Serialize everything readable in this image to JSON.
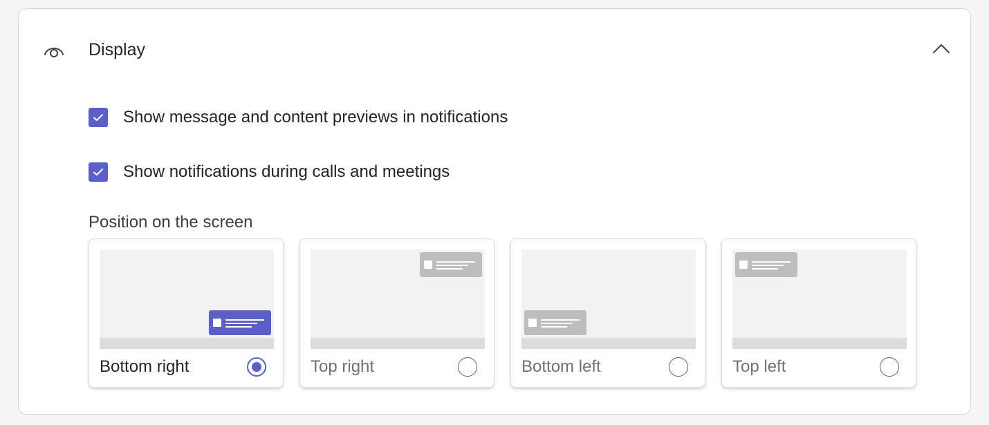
{
  "section": {
    "title": "Display",
    "icon": "eye-icon",
    "collapse_icon": "chevron-up-icon"
  },
  "checkboxes": [
    {
      "label": "Show message and content previews in notifications",
      "checked": true
    },
    {
      "label": "Show notifications during calls and meetings",
      "checked": true
    }
  ],
  "position": {
    "label": "Position on the screen",
    "options": [
      {
        "label": "Bottom right",
        "selected": true
      },
      {
        "label": "Top right",
        "selected": false
      },
      {
        "label": "Bottom left",
        "selected": false
      },
      {
        "label": "Top left",
        "selected": false
      }
    ]
  },
  "colors": {
    "accent": "#5b5fc7",
    "toast_inactive": "#bdbdbd"
  }
}
